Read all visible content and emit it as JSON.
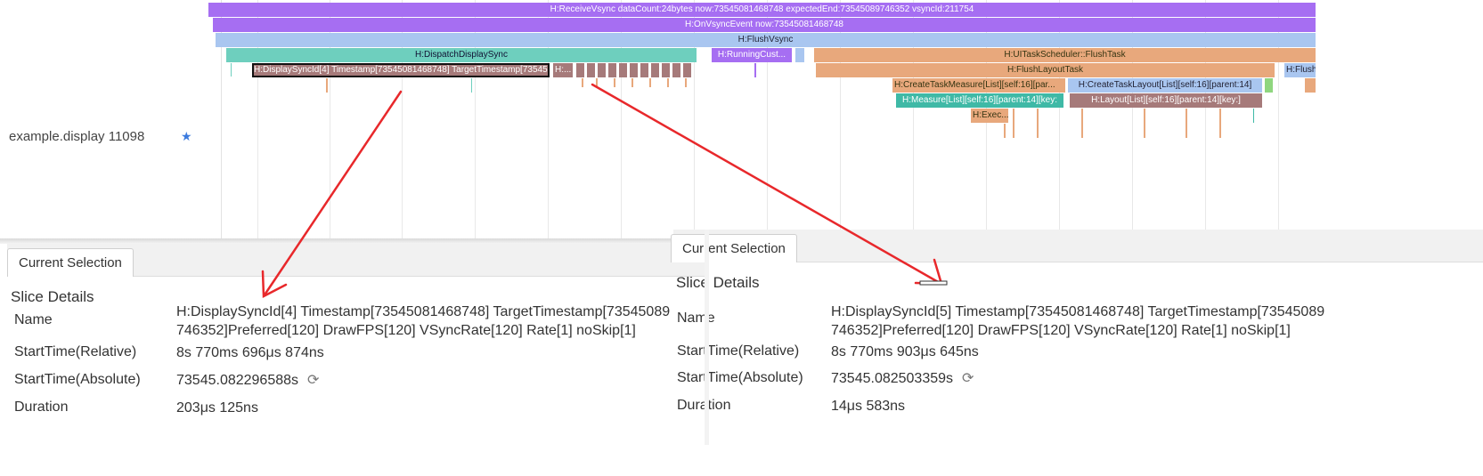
{
  "lane": {
    "process_name": "example.display 11098",
    "star_icon": "star-icon"
  },
  "slices": {
    "receive_vsync": "H:ReceiveVsync dataCount:24bytes now:73545081468748 expectedEnd:73545089746352 vsyncId:211754",
    "on_vsync_event": "H:OnVsyncEvent now:73545081468748",
    "flush_vsync": "H:FlushVsync",
    "dispatch_display_sync": "H:DispatchDisplaySync",
    "running_custom": "H:RunningCust...",
    "ui_task_scheduler": "H:UITaskScheduler::FlushTask",
    "display_sync_id_4": "H:DisplaySyncId[4] Timestamp[73545081468748] TargetTimestamp[735450...",
    "small_h": "H:...",
    "flush_layout_task": "H:FlushLayoutTask",
    "flush_right": "H:Flush",
    "create_task_measure": "H:CreateTaskMeasure[List][self:16][par...",
    "create_task_layout": "H:CreateTaskLayout[List][self:16][parent:14]",
    "measure": "H:Measure[List][self:16][parent:14][key:",
    "layout": "H:Layout[List][self:16][parent:14][key:]",
    "exec": "H:Exec..."
  },
  "colors": {
    "purple": "#a66ef2",
    "light_blue": "#a9c6f0",
    "teal": "#6ecfbe",
    "orange": "#e8a87c",
    "mauve": "#a67a7a",
    "arrow": "#e8282b"
  },
  "left_panel": {
    "tab": "Current Selection",
    "title": "Slice Details",
    "rows": {
      "name_label": "Name",
      "name_value_1": "H:DisplaySyncId[4] Timestamp[73545081468748] TargetTimestamp[73545089",
      "name_value_2": "746352]Preferred[120] DrawFPS[120] VSyncRate[120] Rate[1] noSkip[1]",
      "rel_label": "StartTime(Relative)",
      "rel_value": "8s 770ms 696μs 874ns",
      "abs_label": "StartTime(Absolute)",
      "abs_value": "73545.082296588s",
      "dur_label": "Duration",
      "dur_value": "203μs 125ns"
    }
  },
  "right_panel": {
    "tab": "Current Selection",
    "title": "Slice Details",
    "rows": {
      "name_label": "Name",
      "name_value_1": "H:DisplaySyncId[5] Timestamp[73545081468748] TargetTimestamp[73545089",
      "name_value_2": "746352]Preferred[120] DrawFPS[120] VSyncRate[120] Rate[1] noSkip[1]",
      "rel_label": "StartTime(Relative)",
      "rel_value": "8s 770ms 903μs 645ns",
      "abs_label": "StartTime(Absolute)",
      "abs_value": "73545.082503359s",
      "dur_label": "Duration",
      "dur_value": "14μs 583ns"
    }
  }
}
